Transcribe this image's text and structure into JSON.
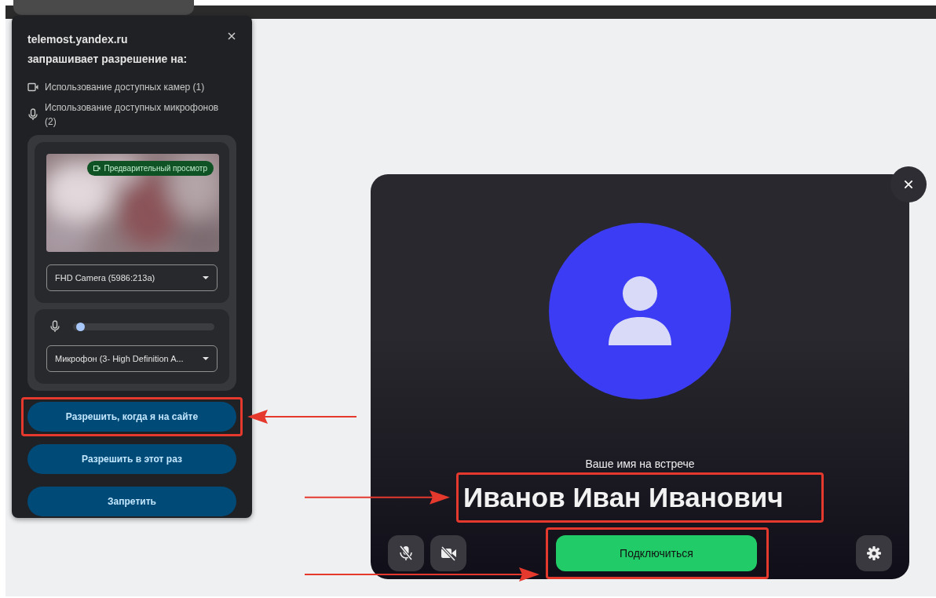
{
  "permission_popup": {
    "site": "telemost.yandex.ru",
    "subtitle": "запрашивает разрешение на:",
    "permissions": [
      {
        "kind": "camera",
        "text": "Использование доступных камер (1)"
      },
      {
        "kind": "microphone",
        "text": "Использование доступных микрофонов (2)"
      }
    ],
    "preview_badge": "Предварительный просмотр",
    "camera_select": "FHD Camera (5986:213a)",
    "mic_meter": {
      "level": 0.02
    },
    "mic_select": "Микрофон (3- High Definition A...",
    "buttons": [
      {
        "label": "Разрешить, когда я на сайте",
        "highlighted": true
      },
      {
        "label": "Разрешить в этот раз",
        "highlighted": false
      },
      {
        "label": "Запретить",
        "highlighted": false
      }
    ]
  },
  "meeting": {
    "name_label": "Ваше имя на встрече",
    "name_value": "Иванов Иван Иванович",
    "name_highlighted": true,
    "mic_muted": true,
    "camera_off": true,
    "connect_button": {
      "label": "Подключиться",
      "highlighted": true
    }
  }
}
